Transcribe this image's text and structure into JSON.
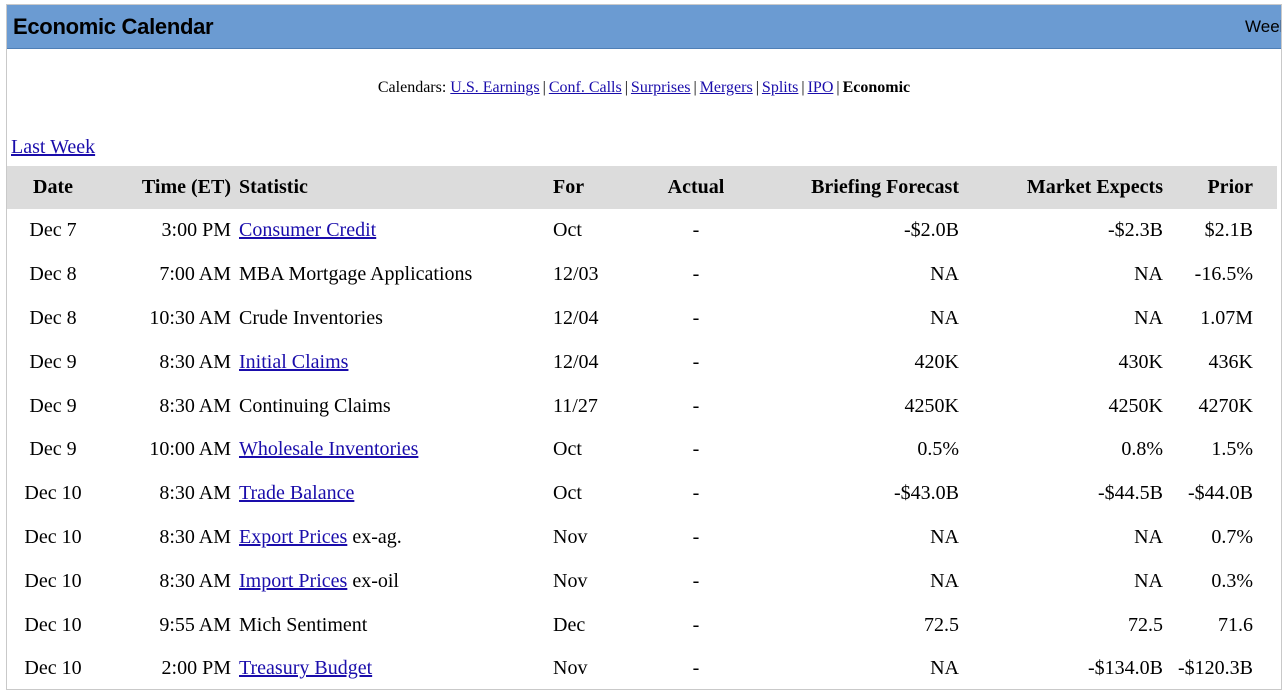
{
  "banner": {
    "title": "Economic Calendar",
    "right_text": "Week"
  },
  "calendars": {
    "label": "Calendars:",
    "links": [
      "U.S. Earnings",
      "Conf. Calls",
      "Surprises",
      "Mergers",
      "Splits",
      "IPO"
    ],
    "current": "Economic"
  },
  "nav": {
    "last_week": "Last Week"
  },
  "table": {
    "headers": [
      "Date",
      "Time (ET)",
      "Statistic",
      "For",
      "Actual",
      "Briefing Forecast",
      "Market Expects",
      "Prior"
    ],
    "rows": [
      {
        "date": "Dec 7",
        "time": "3:00 PM",
        "stat": "Consumer Credit",
        "stat_suffix": "",
        "linked": true,
        "for": "Oct",
        "actual": "-",
        "briefing": "-$2.0B",
        "market": "-$2.3B",
        "prior": "$2.1B"
      },
      {
        "date": "Dec 8",
        "time": "7:00 AM",
        "stat": "MBA Mortgage Applications",
        "stat_suffix": "",
        "linked": false,
        "for": "12/03",
        "actual": "-",
        "briefing": "NA",
        "market": "NA",
        "prior": "-16.5%"
      },
      {
        "date": "Dec 8",
        "time": "10:30 AM",
        "stat": "Crude Inventories",
        "stat_suffix": "",
        "linked": false,
        "for": "12/04",
        "actual": "-",
        "briefing": "NA",
        "market": "NA",
        "prior": "1.07M"
      },
      {
        "date": "Dec 9",
        "time": "8:30 AM",
        "stat": "Initial Claims",
        "stat_suffix": "",
        "linked": true,
        "for": "12/04",
        "actual": "-",
        "briefing": "420K",
        "market": "430K",
        "prior": "436K"
      },
      {
        "date": "Dec 9",
        "time": "8:30 AM",
        "stat": "Continuing Claims",
        "stat_suffix": "",
        "linked": false,
        "for": "11/27",
        "actual": "-",
        "briefing": "4250K",
        "market": "4250K",
        "prior": "4270K"
      },
      {
        "date": "Dec 9",
        "time": "10:00 AM",
        "stat": "Wholesale Inventories",
        "stat_suffix": "",
        "linked": true,
        "for": "Oct",
        "actual": "-",
        "briefing": "0.5%",
        "market": "0.8%",
        "prior": "1.5%"
      },
      {
        "date": "Dec 10",
        "time": "8:30 AM",
        "stat": "Trade Balance",
        "stat_suffix": "",
        "linked": true,
        "for": "Oct",
        "actual": "-",
        "briefing": "-$43.0B",
        "market": "-$44.5B",
        "prior": "-$44.0B"
      },
      {
        "date": "Dec 10",
        "time": "8:30 AM",
        "stat": "Export Prices",
        "stat_suffix": " ex-ag.",
        "linked": true,
        "for": "Nov",
        "actual": "-",
        "briefing": "NA",
        "market": "NA",
        "prior": "0.7%"
      },
      {
        "date": "Dec 10",
        "time": "8:30 AM",
        "stat": "Import Prices",
        "stat_suffix": " ex-oil",
        "linked": true,
        "for": "Nov",
        "actual": "-",
        "briefing": "NA",
        "market": "NA",
        "prior": "0.3%"
      },
      {
        "date": "Dec 10",
        "time": "9:55 AM",
        "stat": "Mich Sentiment",
        "stat_suffix": "",
        "linked": false,
        "for": "Dec",
        "actual": "-",
        "briefing": "72.5",
        "market": "72.5",
        "prior": "71.6"
      },
      {
        "date": "Dec 10",
        "time": "2:00 PM",
        "stat": "Treasury Budget",
        "stat_suffix": "",
        "linked": true,
        "for": "Nov",
        "actual": "-",
        "briefing": "NA",
        "market": "-$134.0B",
        "prior": "-$120.3B"
      }
    ]
  },
  "colors": {
    "banner": "#6b9bd2",
    "header_row": "#dcdcdc",
    "link": "#1a0dab"
  }
}
